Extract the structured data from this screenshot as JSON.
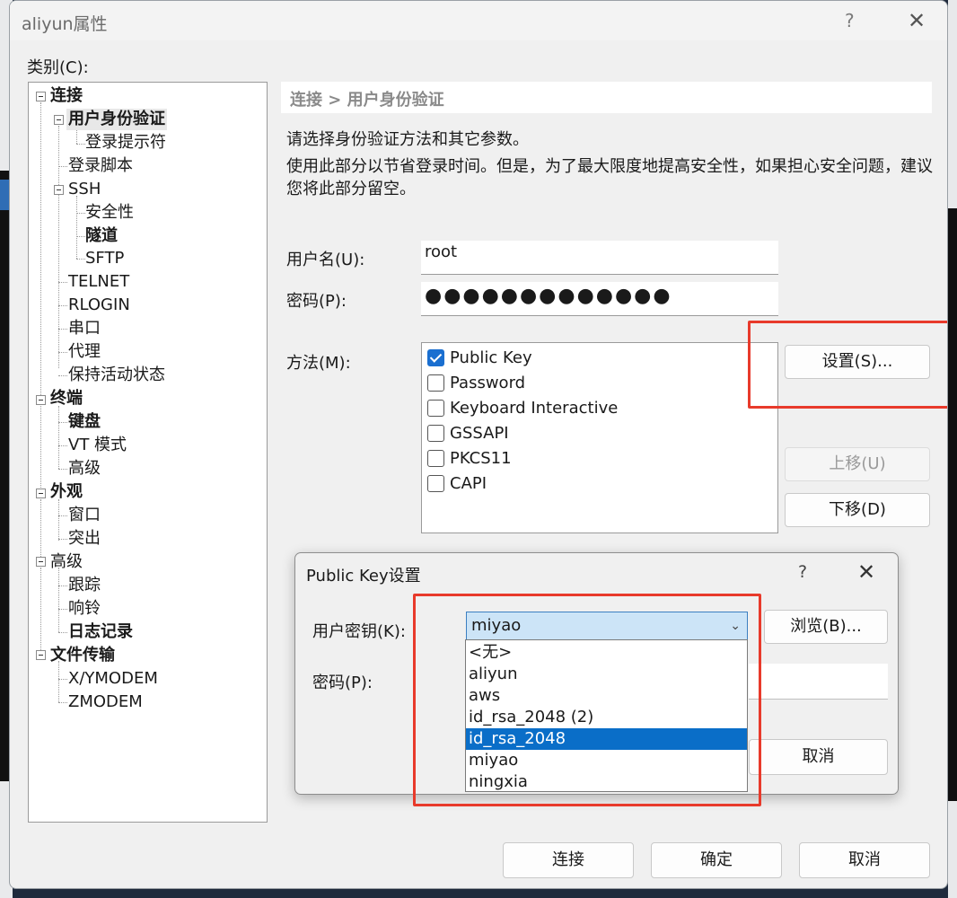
{
  "window": {
    "title": "aliyun属性",
    "help_glyph": "?",
    "close_glyph": "✕"
  },
  "category_label": "类别(C):",
  "tree": {
    "items": [
      {
        "label": "连接"
      },
      {
        "label": "用户身份验证"
      },
      {
        "label": "登录提示符"
      },
      {
        "label": "登录脚本"
      },
      {
        "label": "SSH"
      },
      {
        "label": "安全性"
      },
      {
        "label": "隧道"
      },
      {
        "label": "SFTP"
      },
      {
        "label": "TELNET"
      },
      {
        "label": "RLOGIN"
      },
      {
        "label": "串口"
      },
      {
        "label": "代理"
      },
      {
        "label": "保持活动状态"
      },
      {
        "label": "终端"
      },
      {
        "label": "键盘"
      },
      {
        "label": "VT 模式"
      },
      {
        "label": "高级"
      },
      {
        "label": "外观"
      },
      {
        "label": "窗口"
      },
      {
        "label": "突出"
      },
      {
        "label": "高级"
      },
      {
        "label": "跟踪"
      },
      {
        "label": "响铃"
      },
      {
        "label": "日志记录"
      },
      {
        "label": "文件传输"
      },
      {
        "label": "X/YMODEM"
      },
      {
        "label": "ZMODEM"
      }
    ]
  },
  "panel": {
    "breadcrumb": "连接 > 用户身份验证",
    "description1": "请选择身份验证方法和其它参数。",
    "description2": "使用此部分以节省登录时间。但是，为了最大限度地提高安全性，如果担心安全问题，建议您将此部分留空。",
    "username_label": "用户名(U):",
    "username_value": "root",
    "password_label": "密码(P):",
    "password_value": "●●●●●●●●●●●●●",
    "method_label": "方法(M):",
    "methods": [
      {
        "label": "Public Key",
        "checked": true
      },
      {
        "label": "Password",
        "checked": false
      },
      {
        "label": "Keyboard Interactive",
        "checked": false
      },
      {
        "label": "GSSAPI",
        "checked": false
      },
      {
        "label": "PKCS11",
        "checked": false
      },
      {
        "label": "CAPI",
        "checked": false
      }
    ],
    "settings_button": "设置(S)...",
    "move_up_button": "上移(U)",
    "move_down_button": "下移(D)"
  },
  "footer": {
    "connect_button": "连接",
    "ok_button": "确定",
    "cancel_button": "取消"
  },
  "pubkey_dialog": {
    "title": "Public Key设置",
    "help_glyph": "?",
    "close_glyph": "✕",
    "user_key_label": "用户密钥(K):",
    "user_key_value": "miyao",
    "browse_button": "浏览(B)...",
    "password_label": "密码(P):",
    "cancel_button": "取消",
    "dropdown_options": [
      "<无>",
      "aliyun",
      "aws",
      "id_rsa_2048 (2)",
      "id_rsa_2048",
      "miyao",
      "ningxia"
    ],
    "dropdown_selected_index": 4
  },
  "colors": {
    "accent": "#0a6ec8",
    "highlight_box": "#e83a2b",
    "checkbox": "#1a6fd0"
  }
}
